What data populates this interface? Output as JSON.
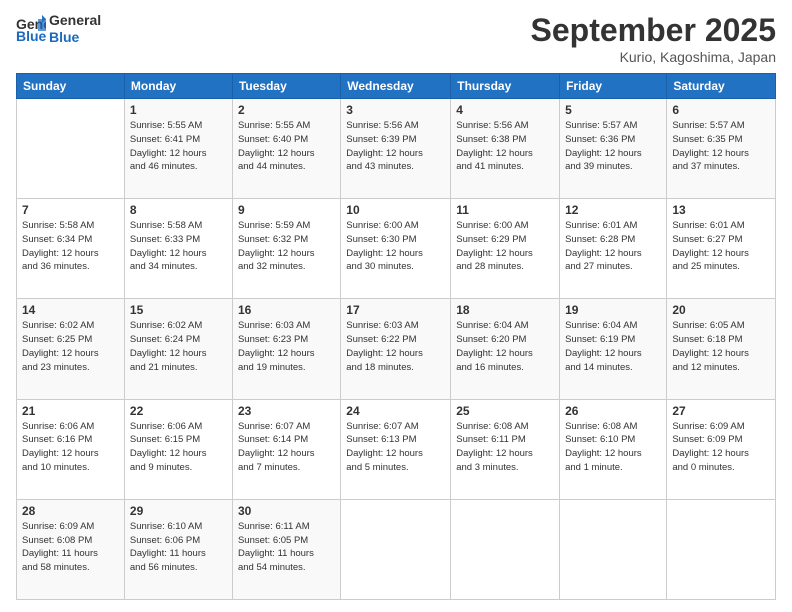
{
  "header": {
    "logo_line1": "General",
    "logo_line2": "Blue",
    "month": "September 2025",
    "location": "Kurio, Kagoshima, Japan"
  },
  "columns": [
    "Sunday",
    "Monday",
    "Tuesday",
    "Wednesday",
    "Thursday",
    "Friday",
    "Saturday"
  ],
  "weeks": [
    [
      {
        "day": "",
        "info": ""
      },
      {
        "day": "1",
        "info": "Sunrise: 5:55 AM\nSunset: 6:41 PM\nDaylight: 12 hours\nand 46 minutes."
      },
      {
        "day": "2",
        "info": "Sunrise: 5:55 AM\nSunset: 6:40 PM\nDaylight: 12 hours\nand 44 minutes."
      },
      {
        "day": "3",
        "info": "Sunrise: 5:56 AM\nSunset: 6:39 PM\nDaylight: 12 hours\nand 43 minutes."
      },
      {
        "day": "4",
        "info": "Sunrise: 5:56 AM\nSunset: 6:38 PM\nDaylight: 12 hours\nand 41 minutes."
      },
      {
        "day": "5",
        "info": "Sunrise: 5:57 AM\nSunset: 6:36 PM\nDaylight: 12 hours\nand 39 minutes."
      },
      {
        "day": "6",
        "info": "Sunrise: 5:57 AM\nSunset: 6:35 PM\nDaylight: 12 hours\nand 37 minutes."
      }
    ],
    [
      {
        "day": "7",
        "info": "Sunrise: 5:58 AM\nSunset: 6:34 PM\nDaylight: 12 hours\nand 36 minutes."
      },
      {
        "day": "8",
        "info": "Sunrise: 5:58 AM\nSunset: 6:33 PM\nDaylight: 12 hours\nand 34 minutes."
      },
      {
        "day": "9",
        "info": "Sunrise: 5:59 AM\nSunset: 6:32 PM\nDaylight: 12 hours\nand 32 minutes."
      },
      {
        "day": "10",
        "info": "Sunrise: 6:00 AM\nSunset: 6:30 PM\nDaylight: 12 hours\nand 30 minutes."
      },
      {
        "day": "11",
        "info": "Sunrise: 6:00 AM\nSunset: 6:29 PM\nDaylight: 12 hours\nand 28 minutes."
      },
      {
        "day": "12",
        "info": "Sunrise: 6:01 AM\nSunset: 6:28 PM\nDaylight: 12 hours\nand 27 minutes."
      },
      {
        "day": "13",
        "info": "Sunrise: 6:01 AM\nSunset: 6:27 PM\nDaylight: 12 hours\nand 25 minutes."
      }
    ],
    [
      {
        "day": "14",
        "info": "Sunrise: 6:02 AM\nSunset: 6:25 PM\nDaylight: 12 hours\nand 23 minutes."
      },
      {
        "day": "15",
        "info": "Sunrise: 6:02 AM\nSunset: 6:24 PM\nDaylight: 12 hours\nand 21 minutes."
      },
      {
        "day": "16",
        "info": "Sunrise: 6:03 AM\nSunset: 6:23 PM\nDaylight: 12 hours\nand 19 minutes."
      },
      {
        "day": "17",
        "info": "Sunrise: 6:03 AM\nSunset: 6:22 PM\nDaylight: 12 hours\nand 18 minutes."
      },
      {
        "day": "18",
        "info": "Sunrise: 6:04 AM\nSunset: 6:20 PM\nDaylight: 12 hours\nand 16 minutes."
      },
      {
        "day": "19",
        "info": "Sunrise: 6:04 AM\nSunset: 6:19 PM\nDaylight: 12 hours\nand 14 minutes."
      },
      {
        "day": "20",
        "info": "Sunrise: 6:05 AM\nSunset: 6:18 PM\nDaylight: 12 hours\nand 12 minutes."
      }
    ],
    [
      {
        "day": "21",
        "info": "Sunrise: 6:06 AM\nSunset: 6:16 PM\nDaylight: 12 hours\nand 10 minutes."
      },
      {
        "day": "22",
        "info": "Sunrise: 6:06 AM\nSunset: 6:15 PM\nDaylight: 12 hours\nand 9 minutes."
      },
      {
        "day": "23",
        "info": "Sunrise: 6:07 AM\nSunset: 6:14 PM\nDaylight: 12 hours\nand 7 minutes."
      },
      {
        "day": "24",
        "info": "Sunrise: 6:07 AM\nSunset: 6:13 PM\nDaylight: 12 hours\nand 5 minutes."
      },
      {
        "day": "25",
        "info": "Sunrise: 6:08 AM\nSunset: 6:11 PM\nDaylight: 12 hours\nand 3 minutes."
      },
      {
        "day": "26",
        "info": "Sunrise: 6:08 AM\nSunset: 6:10 PM\nDaylight: 12 hours\nand 1 minute."
      },
      {
        "day": "27",
        "info": "Sunrise: 6:09 AM\nSunset: 6:09 PM\nDaylight: 12 hours\nand 0 minutes."
      }
    ],
    [
      {
        "day": "28",
        "info": "Sunrise: 6:09 AM\nSunset: 6:08 PM\nDaylight: 11 hours\nand 58 minutes."
      },
      {
        "day": "29",
        "info": "Sunrise: 6:10 AM\nSunset: 6:06 PM\nDaylight: 11 hours\nand 56 minutes."
      },
      {
        "day": "30",
        "info": "Sunrise: 6:11 AM\nSunset: 6:05 PM\nDaylight: 11 hours\nand 54 minutes."
      },
      {
        "day": "",
        "info": ""
      },
      {
        "day": "",
        "info": ""
      },
      {
        "day": "",
        "info": ""
      },
      {
        "day": "",
        "info": ""
      }
    ]
  ]
}
